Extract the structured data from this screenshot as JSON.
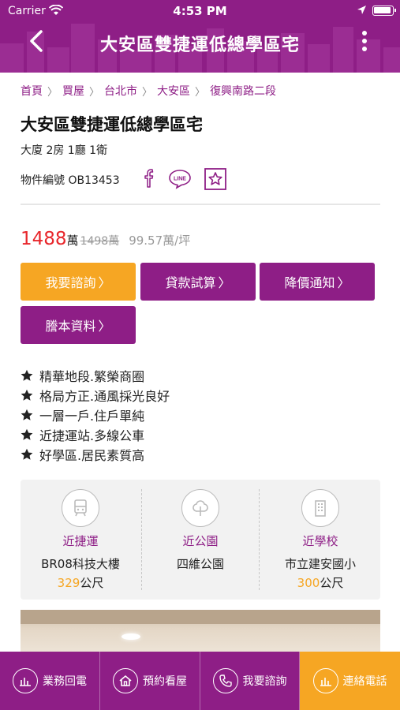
{
  "status_bar": {
    "carrier": "Carrier",
    "time": "4:53 PM"
  },
  "nav": {
    "title": "大安區雙捷運低總學區宅",
    "back_icon": "chevron-left-icon",
    "more_icon": "more-vertical-icon"
  },
  "breadcrumb": [
    "首頁",
    "買屋",
    "台北市",
    "大安區",
    "復興南路二段"
  ],
  "listing": {
    "title": "大安區雙捷運低總學區宅",
    "type": "大廈 2房 1廳 1衛",
    "id_label": "物件編號",
    "id_value": "OB13453"
  },
  "price": {
    "current": "1488",
    "unit": "萬",
    "original": "1498萬",
    "per_ping": "99.57萬/坪"
  },
  "buttons": {
    "inquire": "我要諮詢",
    "loan": "貸款試算",
    "price_alert": "降價通知",
    "transcript": "謄本資料",
    "chevron": "〉"
  },
  "features": [
    "精華地段.繁榮商圈",
    "格局方正.通風採光良好",
    "一層一戶.住戶單純",
    "近捷運站.多線公車",
    "好學區.居民素質高"
  ],
  "nearby": [
    {
      "label": "近捷運",
      "name": "BR08科技大樓",
      "distance": "329",
      "unit": "公尺",
      "icon": "train-icon"
    },
    {
      "label": "近公園",
      "name": "四維公園",
      "distance": "",
      "unit": "",
      "icon": "tree-icon"
    },
    {
      "label": "近學校",
      "name": "市立建安國小",
      "distance": "300",
      "unit": "公尺",
      "icon": "school-icon"
    }
  ],
  "bottom_bar": [
    {
      "label": "業務回電",
      "icon": "callback-icon"
    },
    {
      "label": "預約看屋",
      "icon": "house-icon"
    },
    {
      "label": "我要諮詢",
      "icon": "phone-icon"
    },
    {
      "label": "連絡電話",
      "icon": "call-icon"
    }
  ],
  "colors": {
    "brand_purple": "#8e1e86",
    "accent_orange": "#f6a623",
    "price_red": "#e8262b"
  }
}
